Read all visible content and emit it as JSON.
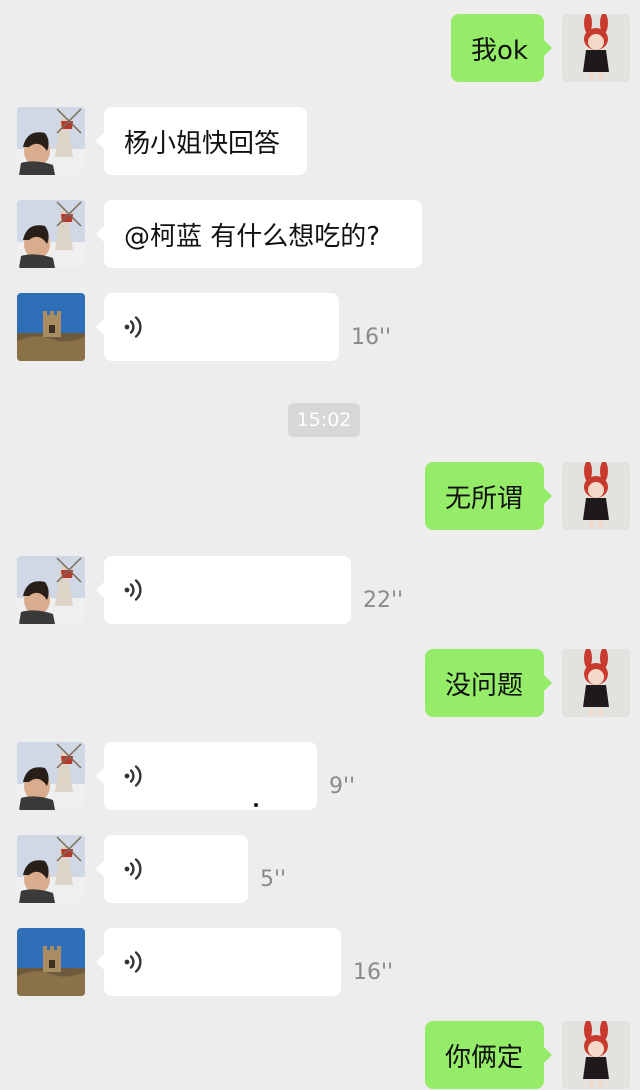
{
  "messages": [
    {
      "id": "m1",
      "side": "right",
      "type": "text",
      "text": "我ok",
      "avatar": "cartoon-girl-avatar"
    },
    {
      "id": "m2",
      "side": "left",
      "type": "text",
      "text": "杨小姐快回答",
      "avatar": "woman-windmill-avatar"
    },
    {
      "id": "m3",
      "side": "left",
      "type": "text",
      "text": "@柯蓝 有什么想吃的?",
      "avatar": "woman-windmill-avatar"
    },
    {
      "id": "m4",
      "side": "left",
      "type": "voice",
      "duration": "16''",
      "avatar": "great-wall-avatar"
    },
    {
      "id": "m5",
      "side": "right",
      "type": "text",
      "text": "无所谓",
      "avatar": "cartoon-girl-avatar"
    },
    {
      "id": "m6",
      "side": "left",
      "type": "voice",
      "duration": "22''",
      "avatar": "woman-windmill-avatar"
    },
    {
      "id": "m7",
      "side": "right",
      "type": "text",
      "text": "没问题",
      "avatar": "cartoon-girl-avatar"
    },
    {
      "id": "m8",
      "side": "left",
      "type": "voice",
      "duration": "9''",
      "avatar": "woman-windmill-avatar"
    },
    {
      "id": "m9",
      "side": "left",
      "type": "voice",
      "duration": "5''",
      "avatar": "woman-windmill-avatar"
    },
    {
      "id": "m10",
      "side": "left",
      "type": "voice",
      "duration": "16''",
      "avatar": "great-wall-avatar"
    },
    {
      "id": "m11",
      "side": "right",
      "type": "text",
      "text": "你俩定",
      "avatar": "cartoon-girl-avatar"
    }
  ],
  "timestamp": "15:02",
  "colors": {
    "background": "#ededed",
    "sent_bubble": "#95ec69",
    "received_bubble": "#ffffff",
    "duration_text": "#8a8a8a",
    "timestamp_bg": "#d7d7d7"
  },
  "icons": {
    "voice": "voice-wave-icon"
  }
}
